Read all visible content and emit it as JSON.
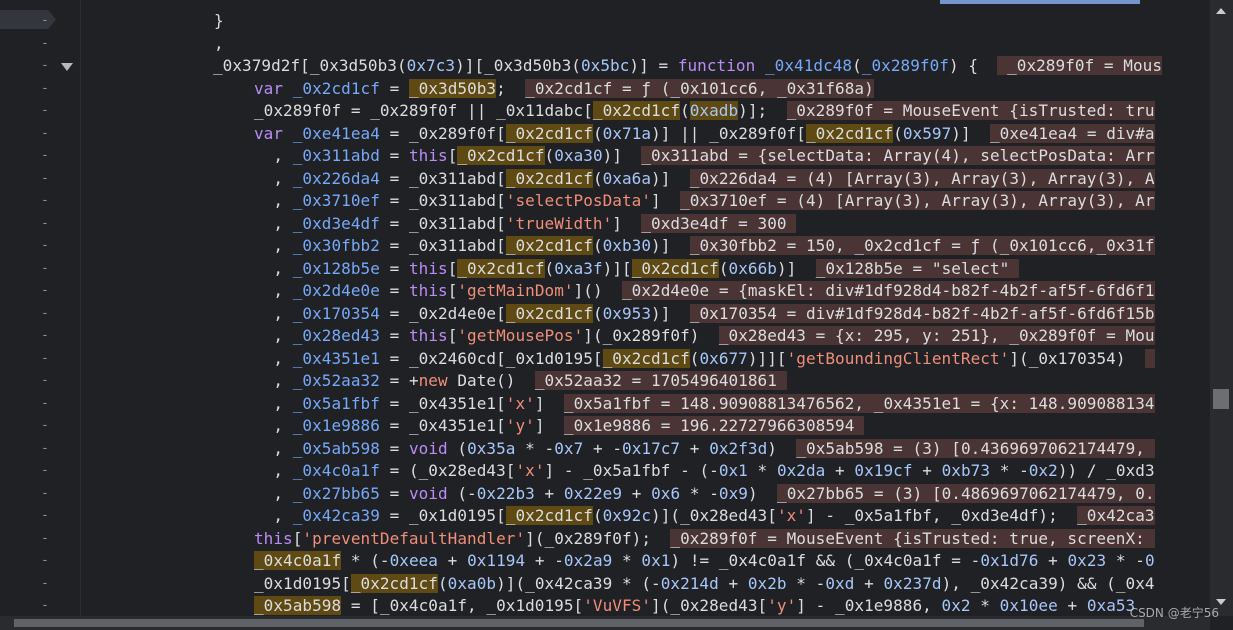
{
  "editor": {
    "lines": [
      [
        [
          "plain",
          "}"
        ]
      ],
      [
        [
          "plain",
          ","
        ]
      ],
      [
        [
          "plain",
          "_0x379d2f[_0x3d50b3("
        ],
        [
          "num",
          "0x7c3"
        ],
        [
          "plain",
          ")][_0x3d50b3("
        ],
        [
          "num",
          "0x5bc"
        ],
        [
          "plain",
          ")] = "
        ],
        [
          "kw",
          "function"
        ],
        [
          "plain",
          " "
        ],
        [
          "id",
          "_0x41dc48"
        ],
        [
          "plain",
          "("
        ],
        [
          "id",
          "_0x289f0f"
        ],
        [
          "plain",
          ") {  "
        ],
        [
          "val",
          " _0x289f0f = Mous"
        ]
      ],
      [
        [
          "kw",
          "var"
        ],
        [
          "plain",
          " "
        ],
        [
          "id",
          "_0x2cd1cf"
        ],
        [
          "plain",
          " = "
        ],
        [
          "hl",
          "_0x3d50b3"
        ],
        [
          "plain",
          ";  "
        ],
        [
          "val",
          "_0x2cd1cf = ƒ (_0x101cc6, _0x31f68a)"
        ]
      ],
      [
        [
          "plain",
          "_0x289f0f = _0x289f0f || _0x11dabc["
        ],
        [
          "hl",
          "_0x2cd1cf"
        ],
        [
          "plain",
          "("
        ],
        [
          "hln",
          "0xadb"
        ],
        [
          "plain",
          ")];  "
        ],
        [
          "val",
          "_0x289f0f = MouseEvent {isTrusted: tru"
        ]
      ],
      [
        [
          "kw",
          "var"
        ],
        [
          "plain",
          " "
        ],
        [
          "id",
          "_0xe41ea4"
        ],
        [
          "plain",
          " = _0x289f0f["
        ],
        [
          "hl",
          "_0x2cd1cf"
        ],
        [
          "plain",
          "("
        ],
        [
          "num",
          "0x71a"
        ],
        [
          "plain",
          ")] || _0x289f0f["
        ],
        [
          "hl",
          "_0x2cd1cf"
        ],
        [
          "plain",
          "("
        ],
        [
          "num",
          "0x597"
        ],
        [
          "plain",
          ")]  "
        ],
        [
          "val",
          "_0xe41ea4 = div#a"
        ]
      ],
      [
        [
          "plain",
          "  , "
        ],
        [
          "id",
          "_0x311abd"
        ],
        [
          "plain",
          " = "
        ],
        [
          "kw",
          "this"
        ],
        [
          "plain",
          "["
        ],
        [
          "hl",
          "_0x2cd1cf"
        ],
        [
          "plain",
          "("
        ],
        [
          "num",
          "0xa30"
        ],
        [
          "plain",
          ")]  "
        ],
        [
          "val",
          "_0x311abd = {selectData: Array(4), selectPosData: Arr"
        ]
      ],
      [
        [
          "plain",
          "  , "
        ],
        [
          "id",
          "_0x226da4"
        ],
        [
          "plain",
          " = _0x311abd["
        ],
        [
          "hl",
          "_0x2cd1cf"
        ],
        [
          "plain",
          "("
        ],
        [
          "num",
          "0xa6a"
        ],
        [
          "plain",
          ")]  "
        ],
        [
          "val",
          "_0x226da4 = (4) [Array(3), Array(3), Array(3), A"
        ]
      ],
      [
        [
          "plain",
          "  , "
        ],
        [
          "id",
          "_0x3710ef"
        ],
        [
          "plain",
          " = _0x311abd["
        ],
        [
          "str",
          "'selectPosData'"
        ],
        [
          "plain",
          "]  "
        ],
        [
          "val",
          "_0x3710ef = (4) [Array(3), Array(3), Array(3), Ar"
        ]
      ],
      [
        [
          "plain",
          "  , "
        ],
        [
          "id",
          "_0xd3e4df"
        ],
        [
          "plain",
          " = _0x311abd["
        ],
        [
          "str",
          "'trueWidth'"
        ],
        [
          "plain",
          "]  "
        ],
        [
          "val",
          "_0xd3e4df = 300 "
        ]
      ],
      [
        [
          "plain",
          "  , "
        ],
        [
          "id",
          "_0x30fbb2"
        ],
        [
          "plain",
          " = _0x311abd["
        ],
        [
          "hl",
          "_0x2cd1cf"
        ],
        [
          "plain",
          "("
        ],
        [
          "num",
          "0xb30"
        ],
        [
          "plain",
          ")]  "
        ],
        [
          "val",
          "_0x30fbb2 = 150, _0x2cd1cf = ƒ (_0x101cc6,_0x31f"
        ]
      ],
      [
        [
          "plain",
          "  , "
        ],
        [
          "id",
          "_0x128b5e"
        ],
        [
          "plain",
          " = "
        ],
        [
          "kw",
          "this"
        ],
        [
          "plain",
          "["
        ],
        [
          "hl",
          "_0x2cd1cf"
        ],
        [
          "plain",
          "("
        ],
        [
          "num",
          "0xa3f"
        ],
        [
          "plain",
          ")]["
        ],
        [
          "hl",
          "_0x2cd1cf"
        ],
        [
          "plain",
          "("
        ],
        [
          "num",
          "0x66b"
        ],
        [
          "plain",
          ")]  "
        ],
        [
          "val",
          "_0x128b5e = \"select\" "
        ]
      ],
      [
        [
          "plain",
          "  , "
        ],
        [
          "id",
          "_0x2d4e0e"
        ],
        [
          "plain",
          " = "
        ],
        [
          "kw",
          "this"
        ],
        [
          "plain",
          "["
        ],
        [
          "str",
          "'getMainDom'"
        ],
        [
          "plain",
          "]()  "
        ],
        [
          "val",
          "_0x2d4e0e = {maskEl: div#1df928d4-b82f-4b2f-af5f-6fd6f1"
        ]
      ],
      [
        [
          "plain",
          "  , "
        ],
        [
          "id",
          "_0x170354"
        ],
        [
          "plain",
          " = _0x2d4e0e["
        ],
        [
          "hl",
          "_0x2cd1cf"
        ],
        [
          "plain",
          "("
        ],
        [
          "num",
          "0x953"
        ],
        [
          "plain",
          ")]  "
        ],
        [
          "val",
          "_0x170354 = div#1df928d4-b82f-4b2f-af5f-6fd6f15b"
        ]
      ],
      [
        [
          "plain",
          "  , "
        ],
        [
          "id",
          "_0x28ed43"
        ],
        [
          "plain",
          " = "
        ],
        [
          "kw",
          "this"
        ],
        [
          "plain",
          "["
        ],
        [
          "str",
          "'getMousePos'"
        ],
        [
          "plain",
          "](_0x289f0f)  "
        ],
        [
          "val",
          "_0x28ed43 = {x: 295, y: 251}, _0x289f0f = Mou"
        ]
      ],
      [
        [
          "plain",
          "  , "
        ],
        [
          "id",
          "_0x4351e1"
        ],
        [
          "plain",
          " = _0x2460cd[_0x1d0195["
        ],
        [
          "hl",
          "_0x2cd1cf"
        ],
        [
          "plain",
          "("
        ],
        [
          "num",
          "0x677"
        ],
        [
          "plain",
          ")]]["
        ],
        [
          "str",
          "'getBoundingClientRect'"
        ],
        [
          "plain",
          "](_0x170354)  "
        ],
        [
          "val",
          " "
        ]
      ],
      [
        [
          "plain",
          "  , "
        ],
        [
          "id",
          "_0x52aa32"
        ],
        [
          "plain",
          " = +"
        ],
        [
          "str",
          "new"
        ],
        [
          "plain",
          " Date()  "
        ],
        [
          "val",
          "_0x52aa32 = 1705496401861 "
        ]
      ],
      [
        [
          "plain",
          "  , "
        ],
        [
          "id",
          "_0x5a1fbf"
        ],
        [
          "plain",
          " = _0x4351e1["
        ],
        [
          "str",
          "'x'"
        ],
        [
          "plain",
          "]  "
        ],
        [
          "val",
          "_0x5a1fbf = 148.90908813476562, _0x4351e1 = {x: 148.909088134"
        ]
      ],
      [
        [
          "plain",
          "  , "
        ],
        [
          "id",
          "_0x1e9886"
        ],
        [
          "plain",
          " = _0x4351e1["
        ],
        [
          "str",
          "'y'"
        ],
        [
          "plain",
          "]  "
        ],
        [
          "val",
          "_0x1e9886 = 196.22727966308594 "
        ]
      ],
      [
        [
          "plain",
          "  , "
        ],
        [
          "id",
          "_0x5ab598"
        ],
        [
          "plain",
          " = "
        ],
        [
          "kw",
          "void"
        ],
        [
          "plain",
          " ("
        ],
        [
          "num",
          "0x35a"
        ],
        [
          "plain",
          " * -"
        ],
        [
          "num",
          "0x7"
        ],
        [
          "plain",
          " + -"
        ],
        [
          "num",
          "0x17c7"
        ],
        [
          "plain",
          " + "
        ],
        [
          "num",
          "0x2f3d"
        ],
        [
          "plain",
          ")  "
        ],
        [
          "val",
          "_0x5ab598 = (3) [0.4369697062174479, "
        ]
      ],
      [
        [
          "plain",
          "  , "
        ],
        [
          "id",
          "_0x4c0a1f"
        ],
        [
          "plain",
          " = (_0x28ed43["
        ],
        [
          "str",
          "'x'"
        ],
        [
          "plain",
          "] - _0x5a1fbf - (-"
        ],
        [
          "num",
          "0x1"
        ],
        [
          "plain",
          " * "
        ],
        [
          "num",
          "0x2da"
        ],
        [
          "plain",
          " + "
        ],
        [
          "num",
          "0x19cf"
        ],
        [
          "plain",
          " + "
        ],
        [
          "num",
          "0xb73"
        ],
        [
          "plain",
          " * -"
        ],
        [
          "num",
          "0x2"
        ],
        [
          "plain",
          ")) / _0xd3"
        ]
      ],
      [
        [
          "plain",
          "  , "
        ],
        [
          "id",
          "_0x27bb65"
        ],
        [
          "plain",
          " = "
        ],
        [
          "kw",
          "void"
        ],
        [
          "plain",
          " (-"
        ],
        [
          "num",
          "0x22b3"
        ],
        [
          "plain",
          " + "
        ],
        [
          "num",
          "0x22e9"
        ],
        [
          "plain",
          " + "
        ],
        [
          "num",
          "0x6"
        ],
        [
          "plain",
          " * -"
        ],
        [
          "num",
          "0x9"
        ],
        [
          "plain",
          ")  "
        ],
        [
          "val",
          "_0x27bb65 = (3) [0.4869697062174479, 0."
        ]
      ],
      [
        [
          "plain",
          "  , "
        ],
        [
          "id",
          "_0x42ca39"
        ],
        [
          "plain",
          " = _0x1d0195["
        ],
        [
          "hl",
          "_0x2cd1cf"
        ],
        [
          "plain",
          "("
        ],
        [
          "num",
          "0x92c"
        ],
        [
          "plain",
          ")](_0x28ed43["
        ],
        [
          "str",
          "'x'"
        ],
        [
          "plain",
          "] - _0x5a1fbf, _0xd3e4df);  "
        ],
        [
          "val",
          "_0x42ca3"
        ]
      ],
      [
        [
          "kw",
          "this"
        ],
        [
          "plain",
          "["
        ],
        [
          "str",
          "'preventDefaultHandler'"
        ],
        [
          "plain",
          "](_0x289f0f);  "
        ],
        [
          "val",
          "_0x289f0f = MouseEvent {isTrusted: true, screenX: "
        ]
      ],
      [
        [
          "hl",
          "_0x4c0a1f"
        ],
        [
          "plain",
          " * (-"
        ],
        [
          "num",
          "0xeea"
        ],
        [
          "plain",
          " + "
        ],
        [
          "num",
          "0x1194"
        ],
        [
          "plain",
          " + -"
        ],
        [
          "num",
          "0x2a9"
        ],
        [
          "plain",
          " * "
        ],
        [
          "num",
          "0x1"
        ],
        [
          "plain",
          ") != _0x4c0a1f && (_0x4c0a1f = -"
        ],
        [
          "num",
          "0x1d76"
        ],
        [
          "plain",
          " + "
        ],
        [
          "num",
          "0x23"
        ],
        [
          "plain",
          " * -"
        ],
        [
          "num",
          "0"
        ]
      ],
      [
        [
          "plain",
          "_0x1d0195["
        ],
        [
          "hl",
          "_0x2cd1cf"
        ],
        [
          "plain",
          "("
        ],
        [
          "num",
          "0xa0b"
        ],
        [
          "plain",
          ")](_0x42ca39 * (-"
        ],
        [
          "num",
          "0x214d"
        ],
        [
          "plain",
          " + "
        ],
        [
          "num",
          "0x2b"
        ],
        [
          "plain",
          " * -"
        ],
        [
          "num",
          "0xd"
        ],
        [
          "plain",
          " + "
        ],
        [
          "num",
          "0x237d"
        ],
        [
          "plain",
          "), _0x42ca39) && (_0x4"
        ]
      ],
      [
        [
          "hl",
          "_0x5ab598"
        ],
        [
          "plain",
          " = [_0x4c0a1f, _0x1d0195["
        ],
        [
          "str",
          "'VuVFS'"
        ],
        [
          "plain",
          "](_0x28ed43["
        ],
        [
          "str",
          "'y'"
        ],
        [
          "plain",
          "] - _0x1e9886, "
        ],
        [
          "num",
          "0x2"
        ],
        [
          "plain",
          " * "
        ],
        [
          "num",
          "0x10ee"
        ],
        [
          "plain",
          " + "
        ],
        [
          "num",
          "0xa53"
        ],
        [
          "plain",
          " "
        ]
      ]
    ]
  },
  "watermark": "CSDN @老宁56"
}
